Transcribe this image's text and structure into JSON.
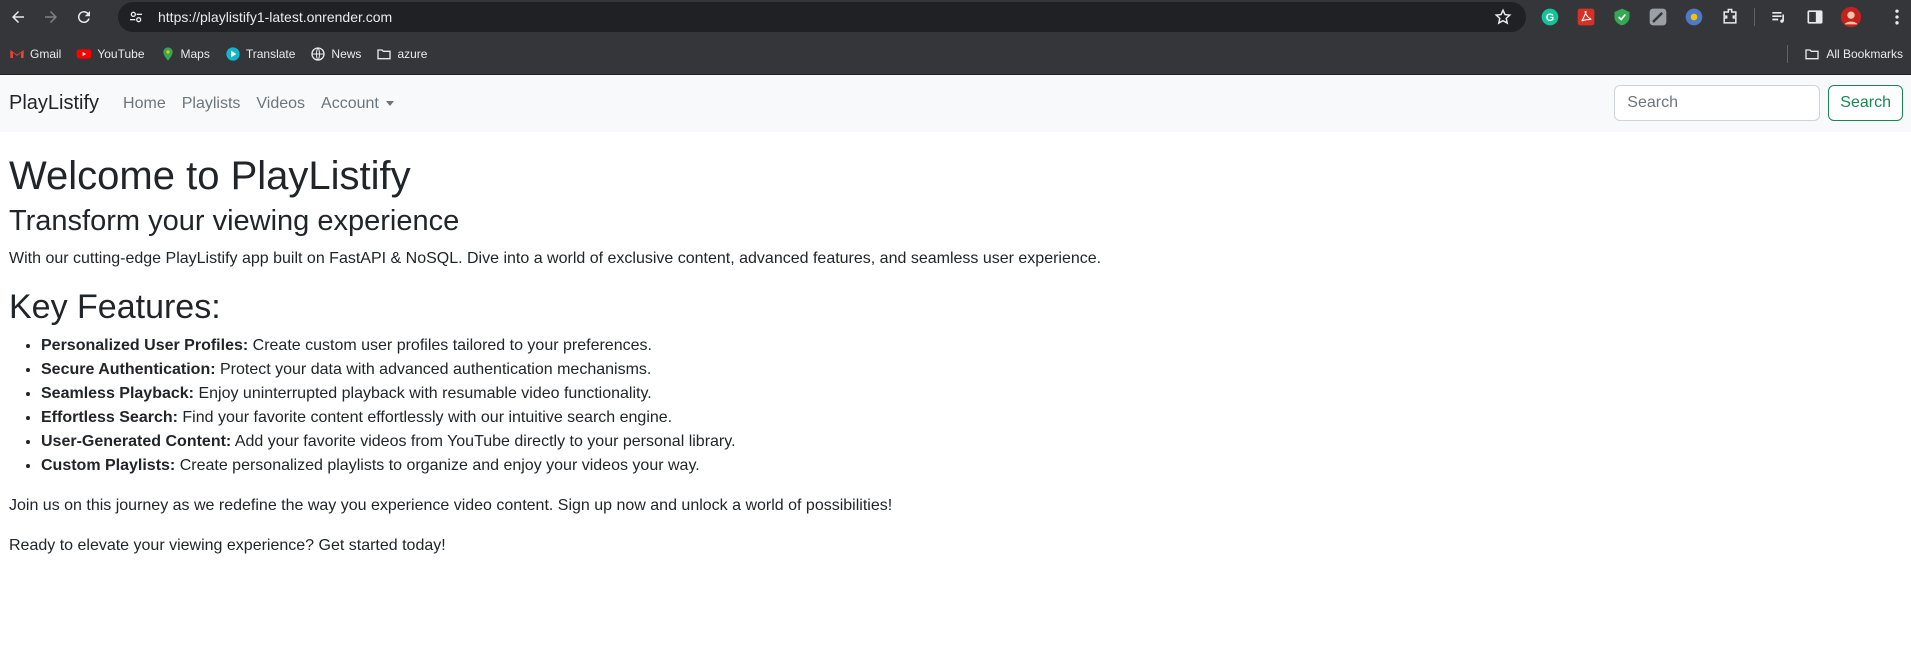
{
  "browser": {
    "url": "https://playlistify1-latest.onrender.com",
    "bookmarks": [
      {
        "label": "Gmail",
        "icon": "gmail-icon"
      },
      {
        "label": "YouTube",
        "icon": "youtube-icon"
      },
      {
        "label": "Maps",
        "icon": "maps-icon"
      },
      {
        "label": "Translate",
        "icon": "translate-icon"
      },
      {
        "label": "News",
        "icon": "news-icon"
      },
      {
        "label": "azure",
        "icon": "folder-icon"
      }
    ],
    "all_bookmarks": "All Bookmarks",
    "colors": {
      "chrome": "#35363a",
      "omnibox": "#202124"
    }
  },
  "navbar": {
    "brand": "PlayListify",
    "links": [
      "Home",
      "Playlists",
      "Videos",
      "Account"
    ],
    "search_placeholder": "Search",
    "search_button": "Search",
    "accent": "#198754"
  },
  "main": {
    "title": "Welcome to PlayListify",
    "subtitle": "Transform your viewing experience",
    "intro": "With our cutting-edge PlayListify app built on FastAPI & NoSQL. Dive into a world of exclusive content, advanced features, and seamless user experience.",
    "features_heading": "Key Features:",
    "features": [
      {
        "name": "Personalized User Profiles:",
        "text": " Create custom user profiles tailored to your preferences."
      },
      {
        "name": "Secure Authentication:",
        "text": " Protect your data with advanced authentication mechanisms."
      },
      {
        "name": "Seamless Playback:",
        "text": " Enjoy uninterrupted playback with resumable video functionality."
      },
      {
        "name": "Effortless Search:",
        "text": " Find your favorite content effortlessly with our intuitive search engine."
      },
      {
        "name": "User-Generated Content:",
        "text": " Add your favorite videos from YouTube directly to your personal library."
      },
      {
        "name": "Custom Playlists:",
        "text": " Create personalized playlists to organize and enjoy your videos your way."
      }
    ],
    "closing": "Join us on this journey as we redefine the way you experience video content. Sign up now and unlock a world of possibilities!",
    "cta": "Ready to elevate your viewing experience? Get started today!"
  }
}
